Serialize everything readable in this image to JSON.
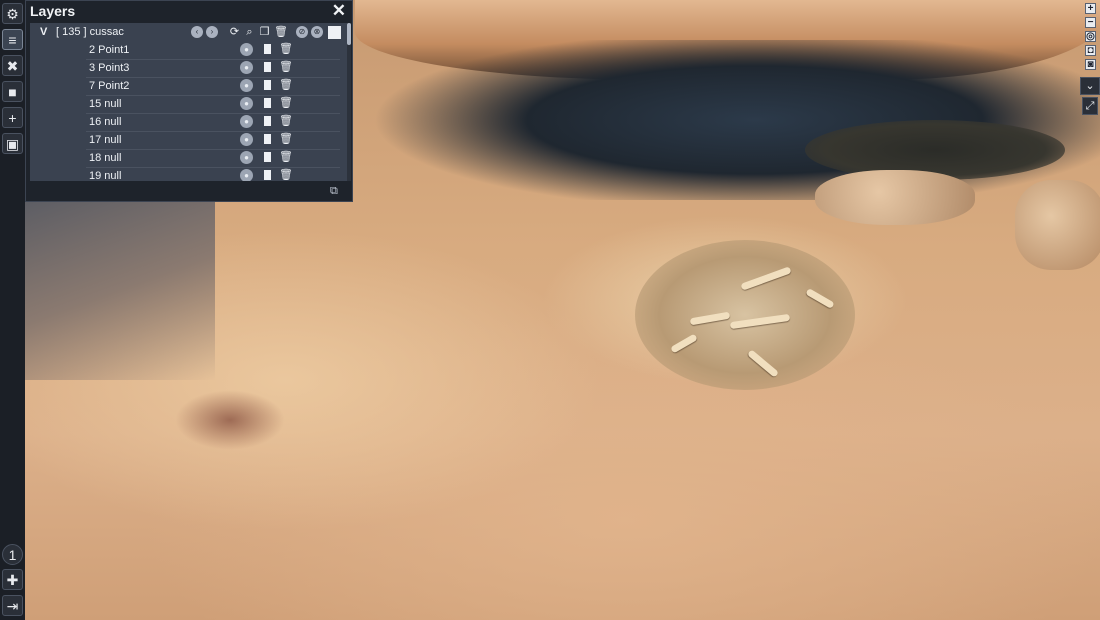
{
  "panel": {
    "title": "Layers",
    "close_icon": "close-icon",
    "root": {
      "expand_label": "V",
      "label": "[ 135 ] cussac"
    },
    "rows": [
      {
        "label": "2 Point1"
      },
      {
        "label": "3 Point3"
      },
      {
        "label": "7 Point2"
      },
      {
        "label": "15 null"
      },
      {
        "label": "16 null"
      },
      {
        "label": "17 null"
      },
      {
        "label": "18 null"
      },
      {
        "label": "19 null"
      }
    ]
  },
  "left_toolbar": {
    "items": [
      {
        "name": "settings",
        "icon": "gear-icon",
        "glyph": "⚙"
      },
      {
        "name": "layers",
        "icon": "layers-icon",
        "glyph": "≡"
      },
      {
        "name": "tools",
        "icon": "tools-icon",
        "glyph": "✖"
      },
      {
        "name": "camera",
        "icon": "video-camera-icon",
        "glyph": "■"
      },
      {
        "name": "add",
        "icon": "plus-icon",
        "glyph": "+"
      },
      {
        "name": "save",
        "icon": "save-icon",
        "glyph": "▣"
      }
    ],
    "bottom_items": [
      {
        "name": "badge",
        "icon": "info-badge-icon",
        "glyph": "1"
      },
      {
        "name": "user",
        "icon": "user-add-icon",
        "glyph": "✚"
      },
      {
        "name": "logout",
        "icon": "logout-icon",
        "glyph": "⇥"
      }
    ]
  },
  "right_toolbar": {
    "items": [
      {
        "name": "zoom-in",
        "icon": "plus-icon",
        "glyph": "+"
      },
      {
        "name": "zoom-out",
        "icon": "minus-icon",
        "glyph": "−"
      },
      {
        "name": "target",
        "icon": "target-icon",
        "glyph": "◎"
      },
      {
        "name": "snapshot",
        "icon": "camera-icon",
        "glyph": "◘"
      },
      {
        "name": "snapshot2",
        "icon": "camera-icon",
        "glyph": "◙"
      }
    ],
    "dropdown_icon": "chevron-down-icon",
    "fullscreen_icon": "fullscreen-icon"
  },
  "colors": {
    "panel_bg": "#1e232b",
    "layer_bg": "#3a4250",
    "toolbar_bg": "#1b1f26",
    "rock": "#dcb08a"
  }
}
